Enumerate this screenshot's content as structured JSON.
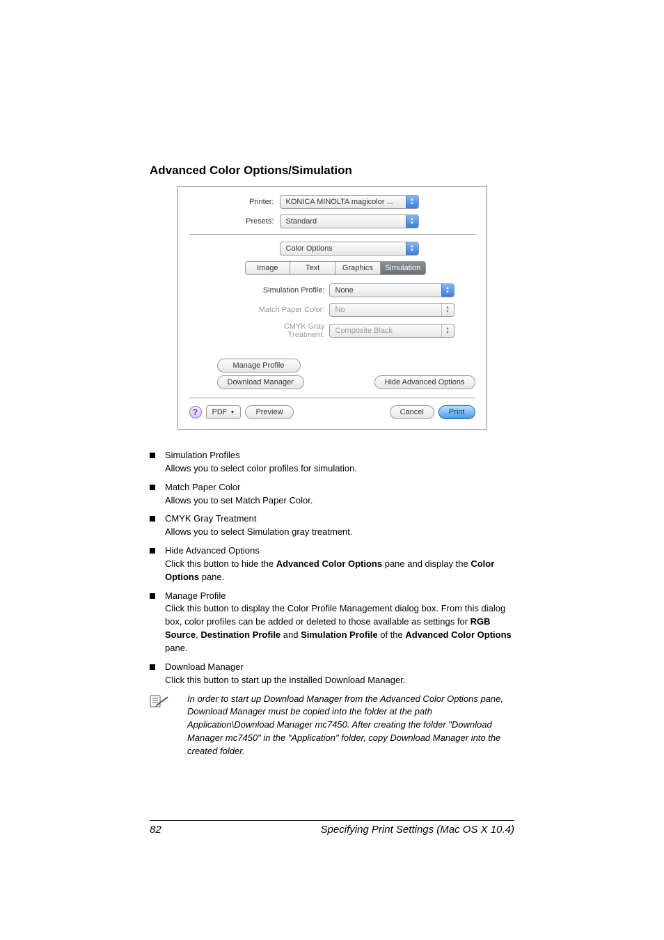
{
  "heading": "Advanced Color Options/Simulation",
  "dialog": {
    "printer_label": "Printer:",
    "printer_value": "KONICA MINOLTA magicolor ...",
    "presets_label": "Presets:",
    "presets_value": "Standard",
    "pane_value": "Color Options",
    "tabs": {
      "image": "Image",
      "text": "Text",
      "graphics": "Graphics",
      "simulation": "Simulation"
    },
    "sim_profile_label": "Simulation Profile:",
    "sim_profile_value": "None",
    "match_paper_label": "Match Paper Color:",
    "match_paper_value": "No",
    "cmyk_gray_label": "CMYK Gray Treatment:",
    "cmyk_gray_value": "Composite Black",
    "manage_profile_btn": "Manage Profile",
    "download_mgr_btn": "Download Manager",
    "hide_adv_btn": "Hide Advanced Options",
    "help": "?",
    "pdf_btn": "PDF",
    "preview_btn": "Preview",
    "cancel_btn": "Cancel",
    "print_btn": "Print"
  },
  "bullets": {
    "b1_title": "Simulation Profiles",
    "b1_desc": "Allows you to select color profiles for simulation.",
    "b2_title": "Match Paper Color",
    "b2_desc": "Allows you to set Match Paper Color.",
    "b3_title": "CMYK Gray Treatment",
    "b3_desc": "Allows you to select Simulation gray treatment.",
    "b4_title": "Hide Advanced Options",
    "b4_pre": "Click this button to hide the ",
    "b4_bold1": "Advanced Color Options",
    "b4_mid": " pane and display the ",
    "b4_bold2": "Color Options",
    "b4_post": " pane.",
    "b5_title": "Manage Profile",
    "b5_l1": "Click this button to display the Color Profile Management dialog box. From this dialog box, color profiles can be added or deleted to those available as settings for ",
    "b5_bold1": "RGB Source",
    "b5_sep1": ", ",
    "b5_bold2": "Destination Profile",
    "b5_sep2": " and ",
    "b5_bold3": "Simulation Profile",
    "b5_sep3": " of the ",
    "b5_bold4": "Advanced Color Options",
    "b5_post": " pane.",
    "b6_title": "Download Manager",
    "b6_desc": "Click this button to start up the installed Download Manager."
  },
  "note": "In order to start up Download Manager from the Advanced Color Options pane, Download Manager must be copied into the folder at the path Application\\Download Manager mc7450. After creating the folder \"Download Manager mc7450\" in the \"Application\" folder, copy Download Manager into the created folder.",
  "footer": {
    "page": "82",
    "title": "Specifying Print Settings (Mac OS X 10.4)"
  }
}
